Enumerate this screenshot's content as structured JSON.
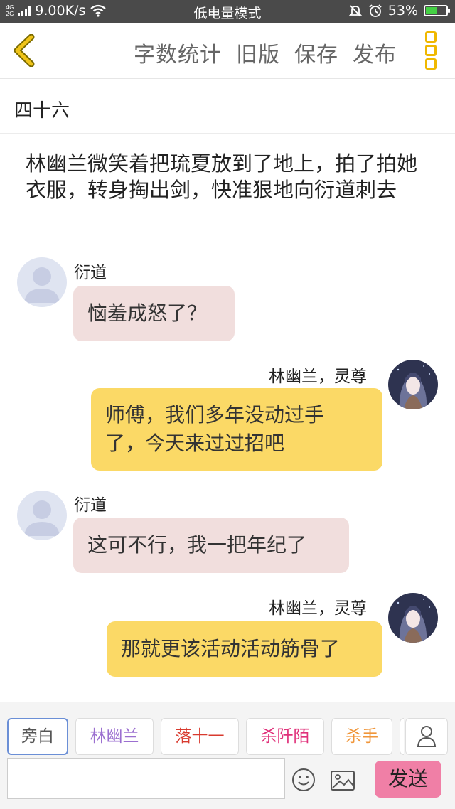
{
  "status_bar": {
    "network_top": "4G",
    "network_bottom": "2G",
    "speed": "9.00K/s",
    "mode": "低电量模式",
    "battery": "53%",
    "battery_level": 0.53
  },
  "toolbar": {
    "actions": [
      "字数统计",
      "旧版",
      "保存",
      "发布"
    ]
  },
  "chapter_title": "四十六",
  "narration": "林幽兰微笑着把琉夏放到了地上，拍了拍她衣服，转身掏出剑，快准狠地向衍道刺去",
  "messages": [
    {
      "side": "left",
      "name": "衍道",
      "text": "恼羞成怒了？"
    },
    {
      "side": "right",
      "name": "林幽兰，灵尊",
      "lines": [
        "师傅，我们多年没动过手",
        "了，今天来过过招吧"
      ]
    },
    {
      "side": "left",
      "name": "衍道",
      "text": "这可不行，我一把年纪了"
    },
    {
      "side": "right",
      "name": "林幽兰，灵尊",
      "text": "那就更该活动活动筋骨了"
    }
  ],
  "roles": [
    {
      "label": "旁白",
      "color": "#555555"
    },
    {
      "label": "林幽兰",
      "color": "#9b6fd0"
    },
    {
      "label": "落十一",
      "color": "#d83a2e"
    },
    {
      "label": "杀阡陌",
      "color": "#e0307a"
    },
    {
      "label": "杀手",
      "color": "#f0963a"
    }
  ],
  "input": {
    "value": "",
    "placeholder": ""
  },
  "send_label": "发送",
  "colors": {
    "accent_yellow": "#f0b800",
    "bubble_left": "#f1dedd",
    "bubble_right": "#fbd966",
    "send": "#f07fa6"
  }
}
